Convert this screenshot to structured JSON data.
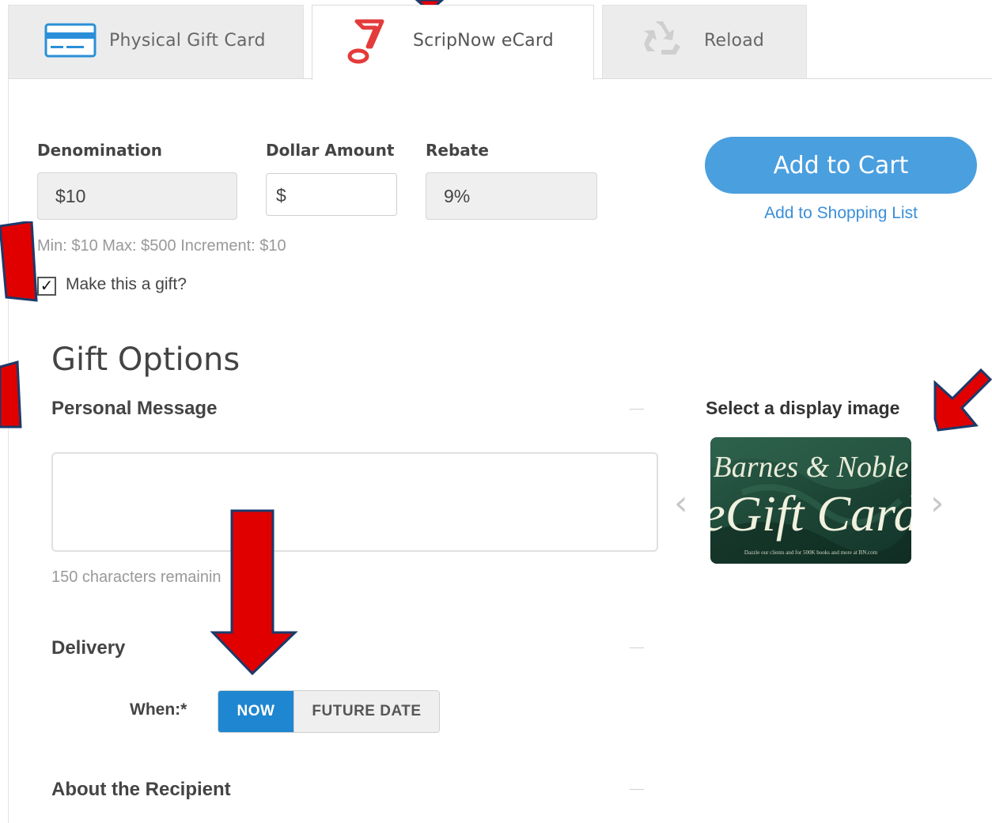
{
  "tabs": [
    {
      "label": "Physical Gift Card",
      "icon": "credit-card-icon"
    },
    {
      "label": "ScripNow eCard",
      "icon": "scripnow-bolt-icon"
    },
    {
      "label": "Reload",
      "icon": "recycle-icon"
    }
  ],
  "purchase": {
    "denomination_label": "Denomination",
    "denomination_value": "$10",
    "amount_label": "Dollar Amount",
    "amount_prefix": "$",
    "rebate_label": "Rebate",
    "rebate_value": "9%",
    "limits": "Min: $10 Max: $500 Increment: $10",
    "gift_checkbox_label": "Make this a gift?",
    "gift_checked": true
  },
  "actions": {
    "add_to_cart": "Add to Cart",
    "add_to_list": "Add to Shopping List"
  },
  "gift_options": {
    "heading": "Gift Options",
    "personal_message": "Personal Message",
    "chars_remaining": "150 characters remainin",
    "delivery": "Delivery",
    "when_label": "When:*",
    "when_options": [
      "NOW",
      "FUTURE DATE"
    ],
    "when_selected": "NOW",
    "about_recipient": "About the Recipient"
  },
  "display_image": {
    "title": "Select a display image",
    "card_line1": "Barnes & Noble",
    "card_line2": "eGift Card",
    "card_fine_print": "Dazzle our clients and for 500K books and more at BN.com",
    "prev": "‹",
    "next": "›"
  },
  "colors": {
    "accent": "#4a9fdf",
    "toggle_active": "#1f86d1",
    "annotation_arrow": "#e00000",
    "card_green": "#1f4a3c"
  }
}
